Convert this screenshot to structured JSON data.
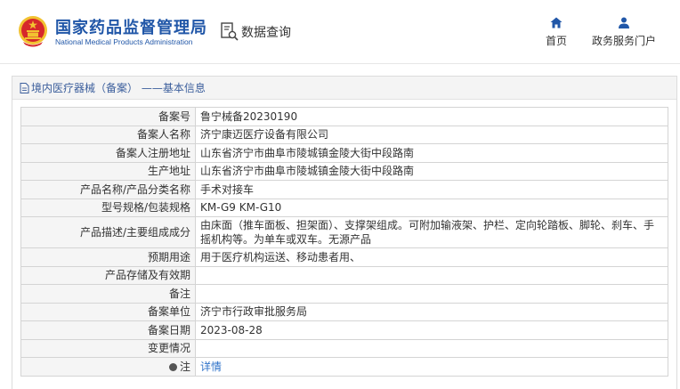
{
  "header": {
    "brand_cn": "国家药品监督管理局",
    "brand_en": "National Medical Products Administration",
    "query_label": "数据查询",
    "nav": [
      {
        "label": "首页",
        "icon": "home-icon"
      },
      {
        "label": "政务服务门户",
        "icon": "user-icon"
      }
    ],
    "colors": {
      "brand": "#2157a8",
      "emblem_red": "#d6282b",
      "emblem_gold": "#f2c230"
    }
  },
  "breadcrumb": "境内医疗器械（备案） ——基本信息",
  "rows": [
    {
      "label": "备案号",
      "value": "鲁宁械备20230190"
    },
    {
      "label": "备案人名称",
      "value": "济宁康迈医疗设备有限公司"
    },
    {
      "label": "备案人注册地址",
      "value": "山东省济宁市曲阜市陵城镇金陵大街中段路南"
    },
    {
      "label": "生产地址",
      "value": "山东省济宁市曲阜市陵城镇金陵大街中段路南"
    },
    {
      "label": "产品名称/产品分类名称",
      "value": "手术对接车"
    },
    {
      "label": "型号规格/包装规格",
      "value": "KM-G9 KM-G10"
    },
    {
      "label": "产品描述/主要组成成分",
      "value": "由床面（推车面板、担架面）、支撑架组成。可附加输液架、护栏、定向轮踏板、脚轮、刹车、手摇机构等。为单车或双车。无源产品"
    },
    {
      "label": "预期用途",
      "value": "用于医疗机构运送、移动患者用、"
    },
    {
      "label": "产品存储及有效期",
      "value": ""
    },
    {
      "label": "备注",
      "value": ""
    },
    {
      "label": "备案单位",
      "value": "济宁市行政审批服务局"
    },
    {
      "label": "备案日期",
      "value": "2023-08-28"
    },
    {
      "label": "变更情况",
      "value": ""
    },
    {
      "label": "注",
      "value": "详情"
    }
  ]
}
